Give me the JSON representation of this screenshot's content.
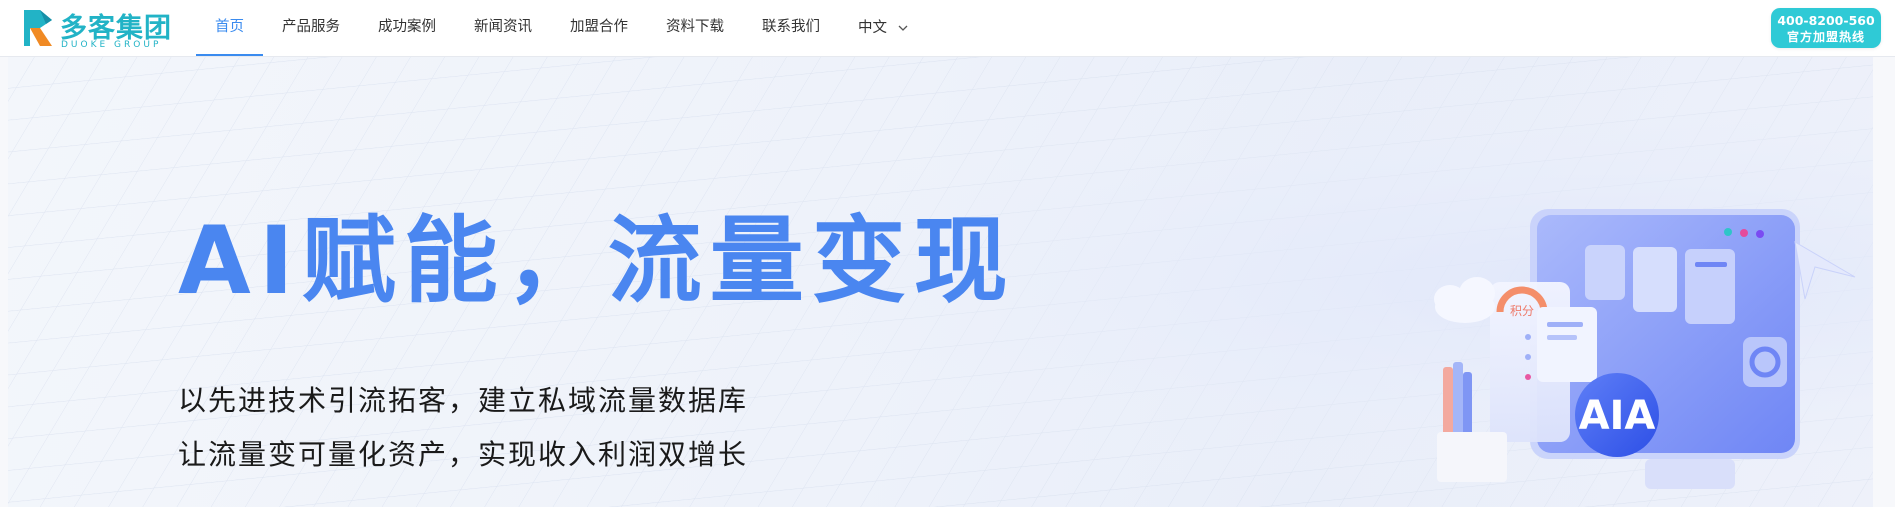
{
  "header": {
    "logo": {
      "cn": "多客集团",
      "en": "DUOKE GROUP"
    },
    "nav": [
      {
        "label": "首页",
        "active": true
      },
      {
        "label": "产品服务"
      },
      {
        "label": "成功案例"
      },
      {
        "label": "新闻资讯"
      },
      {
        "label": "加盟合作"
      },
      {
        "label": "资料下载"
      },
      {
        "label": "联系我们"
      }
    ],
    "language": {
      "label": "中文",
      "icon": "chevron-down-icon"
    },
    "hotline": {
      "number": "400-8200-560",
      "label": "官方加盟热线"
    }
  },
  "hero": {
    "title": "AI赋能，流量变现",
    "subtitle_line1": "以先进技术引流拓客，建立私域流量数据库",
    "subtitle_line2": "让流量变可量化资产，实现收入利润双增长",
    "illustration": {
      "badge": "AIA",
      "stamp": "积分"
    }
  },
  "colors": {
    "accent": "#3a8bef",
    "title_blue": "#4a86f0",
    "brand_teal": "#22b3c6",
    "hotline_bg": "#2fcad6"
  }
}
